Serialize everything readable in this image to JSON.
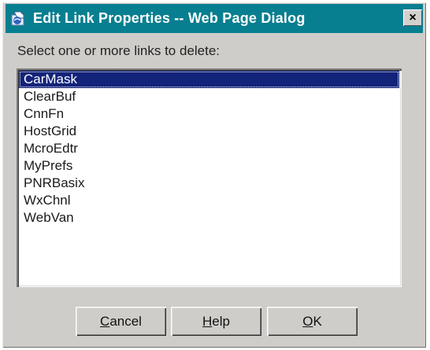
{
  "window": {
    "title": "Edit Link Properties -- Web Page Dialog",
    "close_label": "×",
    "icon": "ie-page-icon"
  },
  "prompt": "Select one or more links to delete:",
  "list": {
    "items": [
      {
        "label": "CarMask",
        "selected": true
      },
      {
        "label": "ClearBuf",
        "selected": false
      },
      {
        "label": "CnnFn",
        "selected": false
      },
      {
        "label": "HostGrid",
        "selected": false
      },
      {
        "label": "McroEdtr",
        "selected": false
      },
      {
        "label": "MyPrefs",
        "selected": false
      },
      {
        "label": "PNRBasix",
        "selected": false
      },
      {
        "label": "WxChnl",
        "selected": false
      },
      {
        "label": "WebVan",
        "selected": false
      }
    ]
  },
  "buttons": {
    "cancel": {
      "mnemonic": "C",
      "rest": "ancel"
    },
    "help": {
      "mnemonic": "H",
      "rest": "elp"
    },
    "ok": {
      "mnemonic": "O",
      "rest": "K"
    }
  },
  "colors": {
    "titlebar": "#087f90",
    "selection": "#12237a",
    "dialog_bg": "#cfcdc9"
  }
}
